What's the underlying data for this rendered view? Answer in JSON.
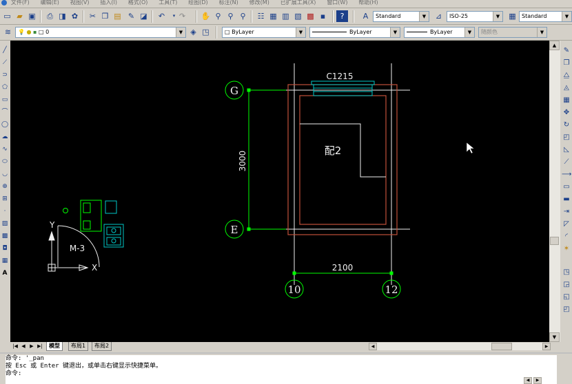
{
  "menu": [
    "文件(F)",
    "编辑(E)",
    "视图(V)",
    "插入(I)",
    "格式(O)",
    "工具(T)",
    "绘图(D)",
    "标注(N)",
    "修改(M)",
    "已扩展工具(X)",
    "窗口(W)",
    "帮助(H)"
  ],
  "styles": {
    "text_style": "Standard",
    "dim_style": "ISO-25",
    "table_style": "Standard"
  },
  "layers": {
    "current_layer": "0",
    "color": "ByLayer",
    "linetype": "ByLayer",
    "lineweight": "ByLayer",
    "plot_style": "随颜色"
  },
  "drawing": {
    "window_label": "C1215",
    "room_label": "配2",
    "door_label": "M-3",
    "dim_vertical": "3000",
    "dim_horizontal": "2100",
    "axis_g": "G",
    "axis_e": "E",
    "axis_10": "10",
    "axis_12": "12",
    "ucs_x": "X",
    "ucs_y": "Y"
  },
  "layout_tabs": [
    "模型",
    "布局1",
    "布局2"
  ],
  "command_lines": [
    "命令: '_pan",
    "按 Esc 或 Enter 键退出，或单击右键显示快捷菜单。",
    "命令:"
  ],
  "colors": {
    "canvas": "#000000",
    "wall": "#c0503a",
    "axis_line": "#f0f0f0",
    "dimension": "#00ff00",
    "furniture": "#00ff00",
    "equipment": "#00c8c8",
    "window": "#00c8c8"
  }
}
